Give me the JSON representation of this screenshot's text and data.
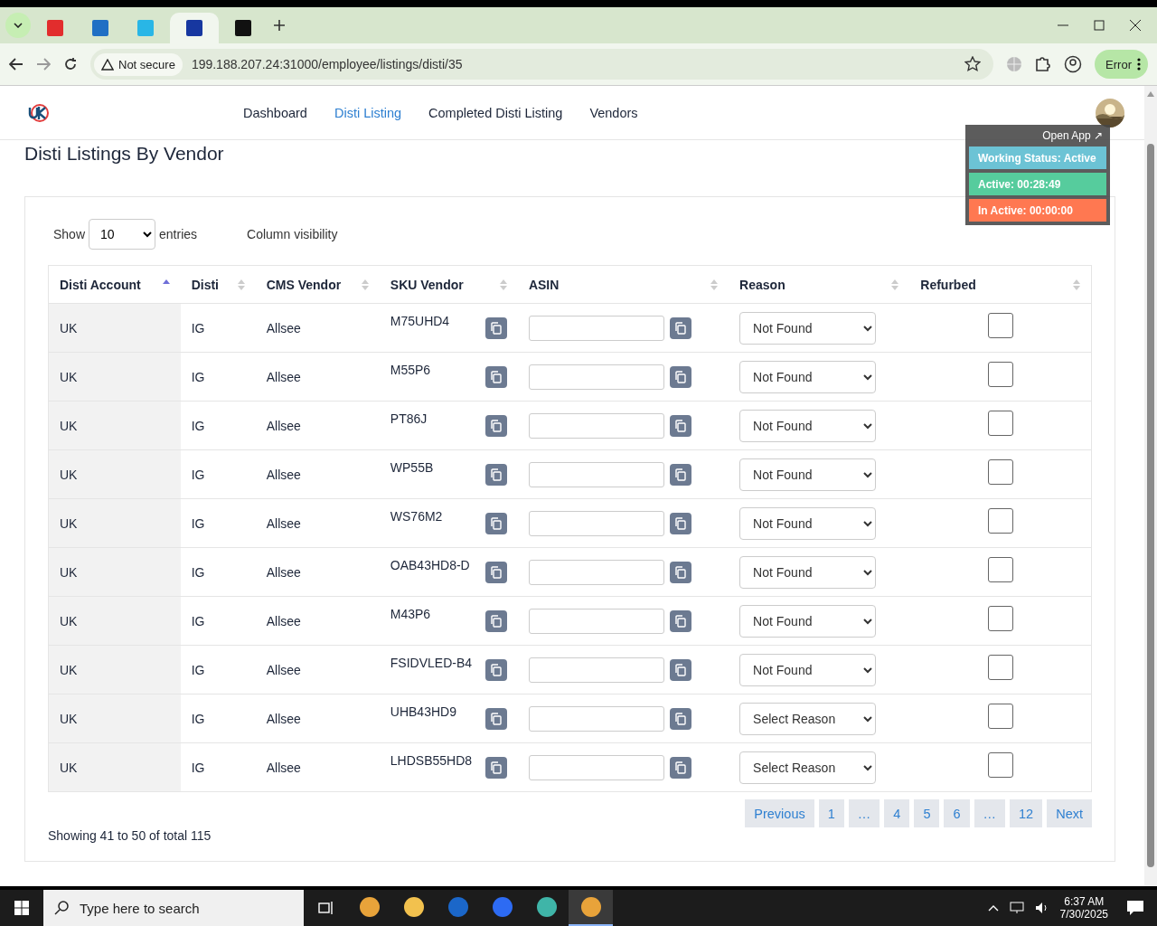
{
  "browser": {
    "tabs": [
      {
        "selected": false
      },
      {
        "selected": false
      },
      {
        "selected": false
      },
      {
        "selected": true
      },
      {
        "selected": false
      }
    ],
    "security": "Not secure",
    "url": "199.188.207.24:31000/employee/listings/disti/35",
    "profile_button": "Error"
  },
  "nav": {
    "items": [
      {
        "label": "Dashboard",
        "selected": false
      },
      {
        "label": "Disti Listing",
        "selected": true
      },
      {
        "label": "Completed Disti Listing",
        "selected": false
      },
      {
        "label": "Vendors",
        "selected": false
      }
    ]
  },
  "page_title": "Disti Listings By Vendor",
  "status_panel": {
    "open_app": "Open App ↗",
    "items": [
      {
        "label": "Working Status: Active",
        "color": "#6cc3d5"
      },
      {
        "label": "Active: 00:28:49",
        "color": "#56cc9d"
      },
      {
        "label": "In Active: 00:00:00",
        "color": "#ff7851"
      }
    ]
  },
  "controls": {
    "show_label": "Show",
    "page_size": "10",
    "entries_label": "entries",
    "column_visibility": "Column visibility"
  },
  "table": {
    "columns": [
      {
        "label": "Disti Account",
        "sorted": true
      },
      {
        "label": "Disti",
        "sorted": false
      },
      {
        "label": "CMS Vendor",
        "sorted": false
      },
      {
        "label": "SKU Vendor",
        "sorted": false
      },
      {
        "label": "ASIN",
        "sorted": false
      },
      {
        "label": "Reason",
        "sorted": false
      },
      {
        "label": "Refurbed",
        "sorted": false
      }
    ],
    "rows": [
      {
        "disti_account": "UK",
        "disti": "IG",
        "cms_vendor": "Allsee",
        "sku_vendor": "M75UHD4",
        "reason": "Not Found",
        "refurbed": false
      },
      {
        "disti_account": "UK",
        "disti": "IG",
        "cms_vendor": "Allsee",
        "sku_vendor": "M55P6",
        "reason": "Not Found",
        "refurbed": false
      },
      {
        "disti_account": "UK",
        "disti": "IG",
        "cms_vendor": "Allsee",
        "sku_vendor": "PT86J",
        "reason": "Not Found",
        "refurbed": false
      },
      {
        "disti_account": "UK",
        "disti": "IG",
        "cms_vendor": "Allsee",
        "sku_vendor": "WP55B",
        "reason": "Not Found",
        "refurbed": false
      },
      {
        "disti_account": "UK",
        "disti": "IG",
        "cms_vendor": "Allsee",
        "sku_vendor": "WS76M2",
        "reason": "Not Found",
        "refurbed": false
      },
      {
        "disti_account": "UK",
        "disti": "IG",
        "cms_vendor": "Allsee",
        "sku_vendor": "OAB43HD8-D",
        "reason": "Not Found",
        "refurbed": false
      },
      {
        "disti_account": "UK",
        "disti": "IG",
        "cms_vendor": "Allsee",
        "sku_vendor": "M43P6",
        "reason": "Not Found",
        "refurbed": false
      },
      {
        "disti_account": "UK",
        "disti": "IG",
        "cms_vendor": "Allsee",
        "sku_vendor": "FSIDVLED-B4",
        "reason": "Not Found",
        "refurbed": false
      },
      {
        "disti_account": "UK",
        "disti": "IG",
        "cms_vendor": "Allsee",
        "sku_vendor": "UHB43HD9",
        "reason": "Select Reason",
        "refurbed": false
      },
      {
        "disti_account": "UK",
        "disti": "IG",
        "cms_vendor": "Allsee",
        "sku_vendor": "LHDSB55HD8",
        "reason": "Select Reason",
        "refurbed": false
      }
    ]
  },
  "summary": "Showing 41 to 50 of total 115",
  "pagination": [
    "Previous",
    "1",
    "…",
    "4",
    "5",
    "6",
    "…",
    "12",
    "Next"
  ],
  "taskbar": {
    "search_placeholder": "Type here to search",
    "apps": [
      {
        "selected": false
      },
      {
        "selected": false
      },
      {
        "selected": false
      },
      {
        "selected": false
      },
      {
        "selected": false
      },
      {
        "selected": true
      }
    ],
    "time": "6:37 AM",
    "date": "7/30/2025"
  }
}
